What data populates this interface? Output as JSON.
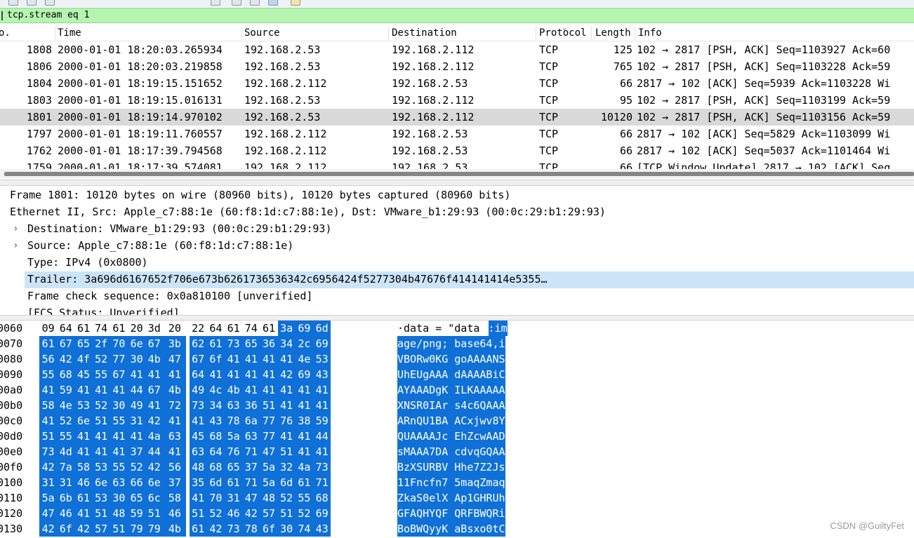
{
  "filter": {
    "value": "tcp.stream eq 1"
  },
  "packet_list": {
    "columns": [
      "o.",
      "Time",
      "Source",
      "Destination",
      "Protocol",
      "Length",
      "Info"
    ],
    "rows": [
      {
        "no": "1808",
        "time": "2000-01-01 18:20:03.265934",
        "src": "192.168.2.53",
        "dst": "192.168.2.112",
        "proto": "TCP",
        "len": "125",
        "info": "102 → 2817 [PSH, ACK] Seq=1103927 Ack=60"
      },
      {
        "no": "1806",
        "time": "2000-01-01 18:20:03.219858",
        "src": "192.168.2.53",
        "dst": "192.168.2.112",
        "proto": "TCP",
        "len": "765",
        "info": "102 → 2817 [PSH, ACK] Seq=1103228 Ack=59"
      },
      {
        "no": "1804",
        "time": "2000-01-01 18:19:15.151652",
        "src": "192.168.2.112",
        "dst": "192.168.2.53",
        "proto": "TCP",
        "len": "66",
        "info": "2817 → 102 [ACK] Seq=5939 Ack=1103228 Wi"
      },
      {
        "no": "1803",
        "time": "2000-01-01 18:19:15.016131",
        "src": "192.168.2.53",
        "dst": "192.168.2.112",
        "proto": "TCP",
        "len": "95",
        "info": "102 → 2817 [PSH, ACK] Seq=1103199 Ack=59"
      },
      {
        "no": "1801",
        "time": "2000-01-01 18:19:14.970102",
        "src": "192.168.2.53",
        "dst": "192.168.2.112",
        "proto": "TCP",
        "len": "10120",
        "info": "102 → 2817 [PSH, ACK] Seq=1103156 Ack=59"
      },
      {
        "no": "1797",
        "time": "2000-01-01 18:19:11.760557",
        "src": "192.168.2.112",
        "dst": "192.168.2.53",
        "proto": "TCP",
        "len": "66",
        "info": "2817 → 102 [ACK] Seq=5829 Ack=1103099 Wi"
      },
      {
        "no": "1762",
        "time": "2000-01-01 18:17:39.794568",
        "src": "192.168.2.112",
        "dst": "192.168.2.53",
        "proto": "TCP",
        "len": "66",
        "info": "2817 → 102 [ACK] Seq=5037 Ack=1101464 Wi"
      },
      {
        "no": "1759",
        "time": "2000-01-01 18:17:39.574081",
        "src": "192.168.2.112",
        "dst": "192.168.2.53",
        "proto": "TCP",
        "len": "66",
        "info": "[TCP Window Update] 2817 → 102 [ACK] Seq"
      }
    ]
  },
  "details": [
    {
      "expander": "",
      "text": "Frame 1801: 10120 bytes on wire (80960 bits), 10120 bytes captured (80960 bits)"
    },
    {
      "expander": "",
      "text": "Ethernet II, Src: Apple_c7:88:1e (60:f8:1d:c7:88:1e), Dst: VMware_b1:29:93 (00:0c:29:b1:29:93)"
    },
    {
      "expander": "›",
      "text": "Destination: VMware_b1:29:93 (00:0c:29:b1:29:93)"
    },
    {
      "expander": "›",
      "text": "Source: Apple_c7:88:1e (60:f8:1d:c7:88:1e)"
    },
    {
      "expander": "",
      "text": "Type: IPv4 (0x0800)"
    },
    {
      "expander": "",
      "text": "Trailer: 3a696d6167652f706e673b6261736536342c6956424f5277304b47676f414141414e5355…"
    },
    {
      "expander": "",
      "text": "Frame check sequence: 0x0a810100 [unverified]"
    },
    {
      "expander": "",
      "text": "[FCS Status: Unverified]"
    }
  ],
  "hex_rows": [
    {
      "off": "0060",
      "bytes": [
        "09",
        "64",
        "61",
        "74",
        "61",
        "20",
        "3d",
        "20",
        "22",
        "64",
        "61",
        "74",
        "61",
        "3a",
        "69",
        "6d"
      ],
      "ascii": "·data =  \"data:im"
    },
    {
      "off": "0070",
      "bytes": [
        "61",
        "67",
        "65",
        "2f",
        "70",
        "6e",
        "67",
        "3b",
        "62",
        "61",
        "73",
        "65",
        "36",
        "34",
        "2c",
        "69"
      ],
      "ascii": "age/png; base64,i"
    },
    {
      "off": "0080",
      "bytes": [
        "56",
        "42",
        "4f",
        "52",
        "77",
        "30",
        "4b",
        "47",
        "67",
        "6f",
        "41",
        "41",
        "41",
        "41",
        "4e",
        "53"
      ],
      "ascii": "VBORw0KG goAAAANS"
    },
    {
      "off": "0090",
      "bytes": [
        "55",
        "68",
        "45",
        "55",
        "67",
        "41",
        "41",
        "41",
        "64",
        "41",
        "41",
        "41",
        "41",
        "42",
        "69",
        "43"
      ],
      "ascii": "UhEUgAAA dAAAABiC"
    },
    {
      "off": "00a0",
      "bytes": [
        "41",
        "59",
        "41",
        "41",
        "41",
        "44",
        "67",
        "4b",
        "49",
        "4c",
        "4b",
        "41",
        "41",
        "41",
        "41",
        "41"
      ],
      "ascii": "AYAAADgK ILKAAAAA"
    },
    {
      "off": "00b0",
      "bytes": [
        "58",
        "4e",
        "53",
        "52",
        "30",
        "49",
        "41",
        "72",
        "73",
        "34",
        "63",
        "36",
        "51",
        "41",
        "41",
        "41"
      ],
      "ascii": "XNSR0IAr s4c6QAAA"
    },
    {
      "off": "00c0",
      "bytes": [
        "41",
        "52",
        "6e",
        "51",
        "55",
        "31",
        "42",
        "41",
        "41",
        "43",
        "78",
        "6a",
        "77",
        "76",
        "38",
        "59"
      ],
      "ascii": "ARnQU1BA ACxjwv8Y"
    },
    {
      "off": "00d0",
      "bytes": [
        "51",
        "55",
        "41",
        "41",
        "41",
        "41",
        "4a",
        "63",
        "45",
        "68",
        "5a",
        "63",
        "77",
        "41",
        "41",
        "44"
      ],
      "ascii": "QUAAAAJc EhZcwAAD"
    },
    {
      "off": "00e0",
      "bytes": [
        "73",
        "4d",
        "41",
        "41",
        "41",
        "37",
        "44",
        "41",
        "63",
        "64",
        "76",
        "71",
        "47",
        "51",
        "41",
        "41"
      ],
      "ascii": "sMAAA7DA cdvqGQAA"
    },
    {
      "off": "00f0",
      "bytes": [
        "42",
        "7a",
        "58",
        "53",
        "55",
        "52",
        "42",
        "56",
        "48",
        "68",
        "65",
        "37",
        "5a",
        "32",
        "4a",
        "73"
      ],
      "ascii": "BzXSURBV Hhe7Z2Js"
    },
    {
      "off": "0100",
      "bytes": [
        "31",
        "31",
        "46",
        "6e",
        "63",
        "66",
        "6e",
        "37",
        "35",
        "6d",
        "61",
        "71",
        "5a",
        "6d",
        "61",
        "71"
      ],
      "ascii": "11Fncfn7 5maqZmaq"
    },
    {
      "off": "0110",
      "bytes": [
        "5a",
        "6b",
        "61",
        "53",
        "30",
        "65",
        "6c",
        "58",
        "41",
        "70",
        "31",
        "47",
        "48",
        "52",
        "55",
        "68"
      ],
      "ascii": "ZkaS0elX Ap1GHRUh"
    },
    {
      "off": "0120",
      "bytes": [
        "47",
        "46",
        "41",
        "51",
        "48",
        "59",
        "51",
        "46",
        "51",
        "52",
        "46",
        "42",
        "57",
        "51",
        "52",
        "69"
      ],
      "ascii": "GFAQHYQF QRFBWQRi"
    },
    {
      "off": "0130",
      "bytes": [
        "42",
        "6f",
        "42",
        "57",
        "51",
        "79",
        "79",
        "4b",
        "61",
        "42",
        "73",
        "78",
        "6f",
        "30",
        "74",
        "43"
      ],
      "ascii": "BoBWQyyK aBsxo0tC"
    }
  ],
  "watermark": "CSDN @GuiltyFet"
}
